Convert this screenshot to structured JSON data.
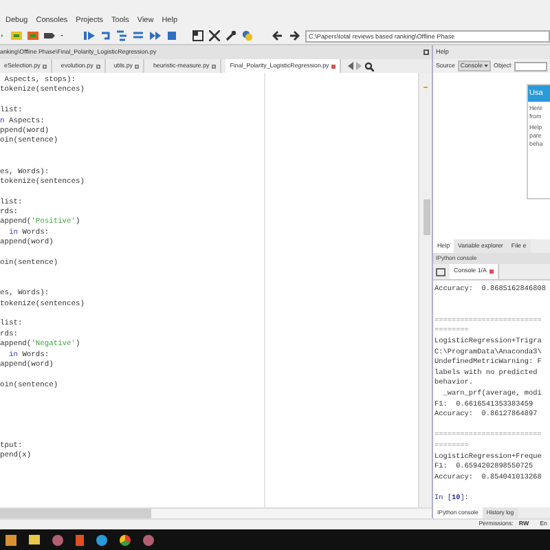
{
  "menu": [
    "Debug",
    "Consoles",
    "Projects",
    "Tools",
    "View",
    "Help"
  ],
  "toolbar": {
    "path": "C:\\Papers\\total reviews based ranking\\Offline Phase"
  },
  "editor": {
    "title": "anking\\Offline Phase\\Final_Polarity_LogisticRegression.py",
    "tabs": [
      {
        "label": "eSelection.py",
        "selected": false
      },
      {
        "label": "evolution.py",
        "selected": false
      },
      {
        "label": "utils.py",
        "selected": false
      },
      {
        "label": "heuristic-measure.py",
        "selected": false
      },
      {
        "label": "Final_Polarity_LogisticRegression.py",
        "selected": true
      }
    ],
    "lines": [
      {
        "kind": "code",
        "segments": [
          {
            "text": " Aspects, stops):",
            "kind": "plain"
          }
        ]
      },
      {
        "kind": "code",
        "segments": [
          {
            "text": "tokenize(sentences)",
            "kind": "plain"
          }
        ]
      },
      {
        "kind": "blank"
      },
      {
        "kind": "code",
        "segments": [
          {
            "text": "list:",
            "kind": "plain"
          }
        ]
      },
      {
        "kind": "code",
        "segments": [
          {
            "text": "n",
            "kind": "keyword"
          },
          {
            "text": " Aspects:",
            "kind": "plain"
          }
        ]
      },
      {
        "kind": "code",
        "segments": [
          {
            "text": "ppend(word)",
            "kind": "plain"
          }
        ]
      },
      {
        "kind": "code",
        "segments": [
          {
            "text": "oin(sentence)",
            "kind": "plain"
          }
        ]
      },
      {
        "kind": "blank"
      },
      {
        "kind": "blank"
      },
      {
        "kind": "code",
        "segments": [
          {
            "text": "es, Words):",
            "kind": "plain"
          }
        ]
      },
      {
        "kind": "code",
        "segments": [
          {
            "text": "tokenize(sentences)",
            "kind": "plain"
          }
        ]
      },
      {
        "kind": "blank"
      },
      {
        "kind": "code",
        "segments": [
          {
            "text": "list:",
            "kind": "plain"
          }
        ]
      },
      {
        "kind": "code",
        "segments": [
          {
            "text": "rds:",
            "kind": "plain"
          }
        ]
      },
      {
        "kind": "code",
        "segments": [
          {
            "text": "append(",
            "kind": "plain"
          },
          {
            "text": "'Positive'",
            "kind": "string"
          },
          {
            "text": ")",
            "kind": "plain"
          }
        ]
      },
      {
        "kind": "code",
        "segments": [
          {
            "text": "  in",
            "kind": "keyword"
          },
          {
            "text": " Words:",
            "kind": "plain"
          }
        ]
      },
      {
        "kind": "code",
        "segments": [
          {
            "text": "append(word)",
            "kind": "plain"
          }
        ]
      },
      {
        "kind": "blank"
      },
      {
        "kind": "code",
        "segments": [
          {
            "text": "oin(sentence)",
            "kind": "plain"
          }
        ]
      },
      {
        "kind": "blank"
      },
      {
        "kind": "blank"
      },
      {
        "kind": "code",
        "segments": [
          {
            "text": "es, Words):",
            "kind": "plain"
          }
        ]
      },
      {
        "kind": "code",
        "segments": [
          {
            "text": "tokenize(sentences)",
            "kind": "plain"
          }
        ]
      },
      {
        "kind": "blank"
      },
      {
        "kind": "code",
        "segments": [
          {
            "text": "list:",
            "kind": "plain"
          }
        ]
      },
      {
        "kind": "code",
        "segments": [
          {
            "text": "rds:",
            "kind": "plain"
          }
        ]
      },
      {
        "kind": "code",
        "segments": [
          {
            "text": "append(",
            "kind": "plain"
          },
          {
            "text": "'Negative'",
            "kind": "string"
          },
          {
            "text": ")",
            "kind": "plain"
          }
        ]
      },
      {
        "kind": "code",
        "segments": [
          {
            "text": "  in",
            "kind": "keyword"
          },
          {
            "text": " Words:",
            "kind": "plain"
          }
        ]
      },
      {
        "kind": "code",
        "segments": [
          {
            "text": "append(word)",
            "kind": "plain"
          }
        ]
      },
      {
        "kind": "blank"
      },
      {
        "kind": "code",
        "segments": [
          {
            "text": "oin(sentence)",
            "kind": "plain"
          }
        ]
      },
      {
        "kind": "blank"
      },
      {
        "kind": "blank"
      },
      {
        "kind": "blank"
      },
      {
        "kind": "blank"
      },
      {
        "kind": "blank"
      },
      {
        "kind": "code",
        "segments": [
          {
            "text": "tput:",
            "kind": "plain"
          }
        ]
      },
      {
        "kind": "code",
        "segments": [
          {
            "text": "pend(x)",
            "kind": "plain"
          }
        ]
      }
    ]
  },
  "help": {
    "title": "Help",
    "source_label": "Source",
    "source_value": "Console",
    "object_label": "Object",
    "usage_title": "Usa",
    "usage_lines": [
      "Here",
      "from",
      "Help",
      "pare",
      "beha"
    ]
  },
  "pane_tabs": [
    {
      "label": "Help",
      "selected": true
    },
    {
      "label": "Variable explorer",
      "selected": false
    },
    {
      "label": "File e",
      "selected": false
    }
  ],
  "console": {
    "title": "IPython console",
    "tabs": [
      {
        "label": "Console 1/A",
        "selected": true
      }
    ],
    "lines": [
      {
        "kind": "output",
        "text": "Accuracy:  0.8685162846808"
      },
      {
        "kind": "blank"
      },
      {
        "kind": "blank"
      },
      {
        "kind": "separator",
        "text": "========================="
      },
      {
        "kind": "separator",
        "text": "========"
      },
      {
        "kind": "output",
        "text": "LogisticRegression+Trigra"
      },
      {
        "kind": "output",
        "text": "C:\\ProgramData\\Anaconda3\\"
      },
      {
        "kind": "output",
        "text": "UndefinedMetricWarning: F"
      },
      {
        "kind": "output",
        "text": "labels with no predicted"
      },
      {
        "kind": "output",
        "text": "behavior."
      },
      {
        "kind": "output",
        "text": "  _warn_prf(average, modi"
      },
      {
        "kind": "output",
        "text": "F1:  0.6616541353383459"
      },
      {
        "kind": "output",
        "text": "Accuracy:  0.86127864897"
      },
      {
        "kind": "blank"
      },
      {
        "kind": "separator",
        "text": "========================="
      },
      {
        "kind": "separator",
        "text": "========"
      },
      {
        "kind": "output",
        "text": "LogisticRegression+Freque"
      },
      {
        "kind": "output",
        "text": "F1:  0.6594202898550725"
      },
      {
        "kind": "output",
        "text": "Accuracy:  0.854041013268"
      },
      {
        "kind": "blank"
      },
      {
        "kind": "prompt",
        "text": "In [**10**]:"
      }
    ]
  },
  "bottom_tabs": [
    {
      "label": "IPython console",
      "selected": true
    },
    {
      "label": "History log",
      "selected": false
    }
  ],
  "status_bar": {
    "permissions_label": "Permissions:",
    "permissions_value": "RW",
    "encoding": "En"
  }
}
